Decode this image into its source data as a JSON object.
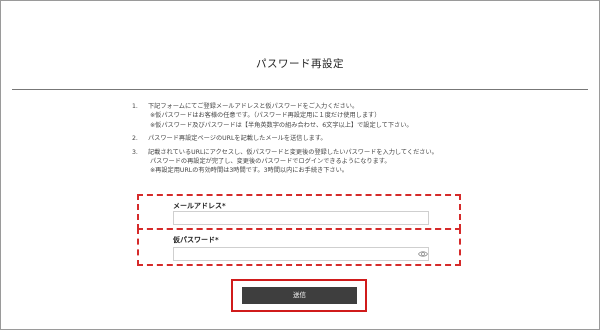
{
  "page": {
    "title": "パスワード再設定"
  },
  "instructions": [
    {
      "num": "1.",
      "lines": [
        "下記フォームにてご登録メールアドレスと仮パスワードをご入力ください。",
        "※仮パスワードはお客様の任意です。（パスワード再設定用に１度だけ使用します）",
        "※仮パスワード及びパスワードは【半角英数字の組み合わせ、6文字以上】で設定して下さい。"
      ]
    },
    {
      "num": "2.",
      "lines": [
        "パスワード再設定ページのURLを記載したメールを送信します。"
      ]
    },
    {
      "num": "3.",
      "lines": [
        "記載されているURLにアクセスし、仮パスワードと変更後の登録したいパスワードを入力してください。",
        "パスワードの再設定が完了し、変更後のパスワードでログインできるようになります。",
        "※再設定用URLの有効時間は3時間です。3時間以内にお手続き下さい。"
      ]
    }
  ],
  "form": {
    "email_label": "メールアドレス*",
    "email_value": "",
    "temp_password_label": "仮パスワード*",
    "temp_password_value": "",
    "password_toggle_icon": "eye-icon"
  },
  "submit": {
    "label": "送信"
  },
  "colors": {
    "highlight": "#d52a2a",
    "button_bg": "#3e3e3e"
  }
}
